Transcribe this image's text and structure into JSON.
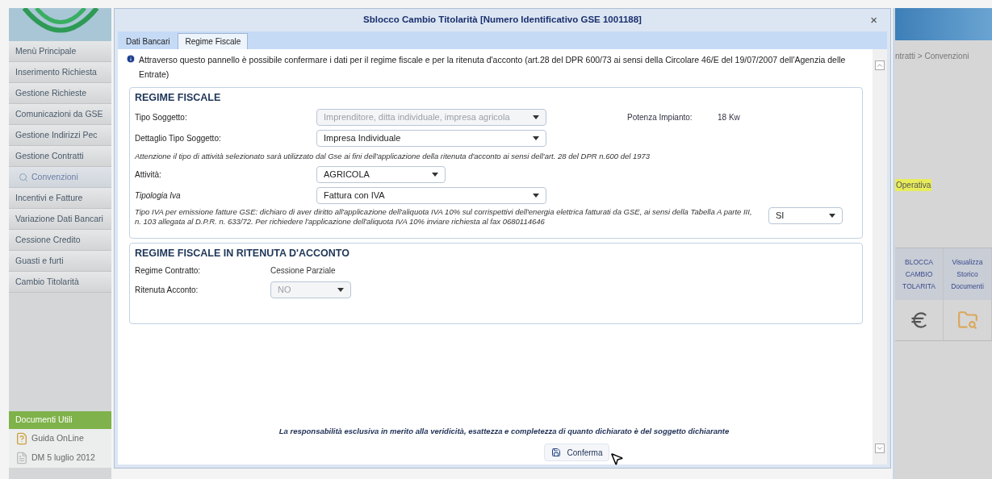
{
  "sidebar": {
    "menu": [
      {
        "label": "Menù Principale",
        "selected": false
      },
      {
        "label": "Inserimento Richiesta",
        "selected": false
      },
      {
        "label": "Gestione Richieste",
        "selected": false
      },
      {
        "label": "Comunicazioni da GSE",
        "selected": false
      },
      {
        "label": "Gestione Indirizzi Pec",
        "selected": false
      },
      {
        "label": "Gestione Contratti",
        "selected": false
      },
      {
        "label": "Convenzioni",
        "selected": true
      },
      {
        "label": "Incentivi e Fatture",
        "selected": false
      },
      {
        "label": "Variazione Dati Bancari",
        "selected": false
      },
      {
        "label": "Cessione Credito",
        "selected": false
      },
      {
        "label": "Guasti e furti",
        "selected": false
      },
      {
        "label": "Cambio Titolarità",
        "selected": false
      }
    ],
    "docs_header": "Documenti Utili",
    "docs": [
      {
        "label": "Guida OnLine",
        "kind": "help"
      },
      {
        "label": "DM 5 luglio 2012",
        "kind": "doc"
      }
    ]
  },
  "dialog": {
    "title": "Sblocco Cambio Titolarità [Numero Identificativo GSE 1001188]",
    "close": "×",
    "tabs": [
      {
        "label": "Dati Bancari",
        "selected": false
      },
      {
        "label": "Regime Fiscale",
        "selected": true
      }
    ],
    "info": "Attraverso questo pannello è possibile confermare i dati per il regime fiscale e per la ritenuta d'acconto (art.28 del DPR 600/73 ai sensi della Circolare 46/E del 19/07/2007 dell'Agenzia delle Entrate)",
    "sections": [
      {
        "title": "REGIME FISCALE",
        "rows": [
          {
            "kind": "field",
            "label": "Tipo Soggetto:",
            "italic": false,
            "value": "Imprenditore, ditta individuale, impresa agricola",
            "disabled": true,
            "aside": {
              "label": "Potenza Impianto:",
              "value": "18 Kw"
            }
          },
          {
            "kind": "field",
            "label": "Dettaglio Tipo Soggetto:",
            "italic": false,
            "value": "Impresa Individuale",
            "disabled": false
          },
          {
            "kind": "note",
            "text": "Attenzione il tipo di attività selezionato sarà utilizzato dal Gse ai fini dell'applicazione della ritenuta d'acconto ai sensi dell'art. 28 del DPR n.600 del 1973"
          },
          {
            "kind": "short_field",
            "label": "Attività:",
            "italic": false,
            "value": "AGRICOLA",
            "disabled": false
          },
          {
            "kind": "field",
            "label": "Tipologia Iva",
            "italic": true,
            "value": "Fattura con IVA",
            "disabled": false
          },
          {
            "kind": "note_select",
            "text": "Tipo IVA per emissione fatture GSE: dichiaro di aver diritto all'applicazione dell'aliquota IVA 10% sul corrispettivi dell'energia elettrica fatturati da GSE, ai sensi della Tabella A parte III, n. 103 allegata al D.P.R. n. 633/72. Per richiedere l'applicazione dell'aliquota IVA 10% inviare richiesta al fax 0680114646",
            "value": "SI",
            "disabled": false
          }
        ]
      },
      {
        "title": "REGIME FISCALE IN RITENUTA D'ACCONTO",
        "rows": [
          {
            "kind": "text",
            "label": "Regime Contratto:",
            "value": "Cessione Parziale"
          },
          {
            "kind": "short_field",
            "label": "Ritenuta Acconto:",
            "italic": false,
            "value": "NO",
            "disabled": true
          }
        ]
      }
    ],
    "disclaimer": "La responsabilità esclusiva in merito alla veridicità, esattezza e completezza di quanto dichiarato è del soggetto dichiarante",
    "confirm_button": "Conferma"
  },
  "background": {
    "breadcrumb": "ntratti > Convenzioni",
    "highlight": "Operativa",
    "actions": [
      {
        "lines": [
          "BLOCCA",
          "CAMBIO",
          "TOLARITA"
        ],
        "kind": "euro"
      },
      {
        "lines": [
          "Visualizza",
          "Storico",
          "Documenti"
        ],
        "kind": "folder"
      }
    ]
  }
}
